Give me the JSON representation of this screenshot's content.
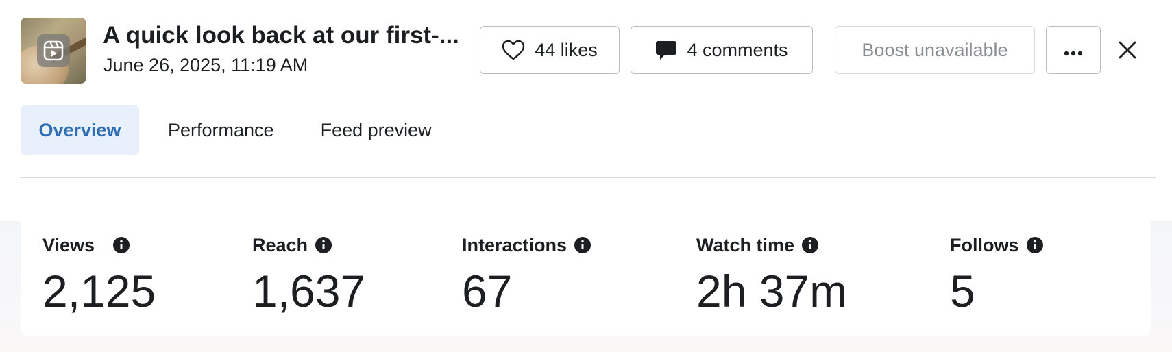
{
  "post": {
    "title": "A quick look back at our first-...",
    "date": "June 26, 2025, 11:19 AM",
    "thumbnail_icon": "reels-icon"
  },
  "actions": {
    "likes_label": "44 likes",
    "comments_label": "4 comments",
    "boost_label": "Boost unavailable",
    "more_icon": "more-horizontal-icon",
    "close_icon": "close-icon"
  },
  "tabs": [
    {
      "label": "Overview",
      "active": true
    },
    {
      "label": "Performance",
      "active": false
    },
    {
      "label": "Feed preview",
      "active": false
    }
  ],
  "stats": [
    {
      "label": "Views",
      "value": "2,125"
    },
    {
      "label": "Reach",
      "value": "1,637"
    },
    {
      "label": "Interactions",
      "value": "67"
    },
    {
      "label": "Watch time",
      "value": "2h 37m"
    },
    {
      "label": "Follows",
      "value": "5"
    }
  ],
  "colors": {
    "accent": "#2f6db3",
    "active_tab_bg": "#e7f0fb",
    "text": "#1c1e21",
    "muted": "#8a8d91",
    "border": "#b8bcc4"
  }
}
